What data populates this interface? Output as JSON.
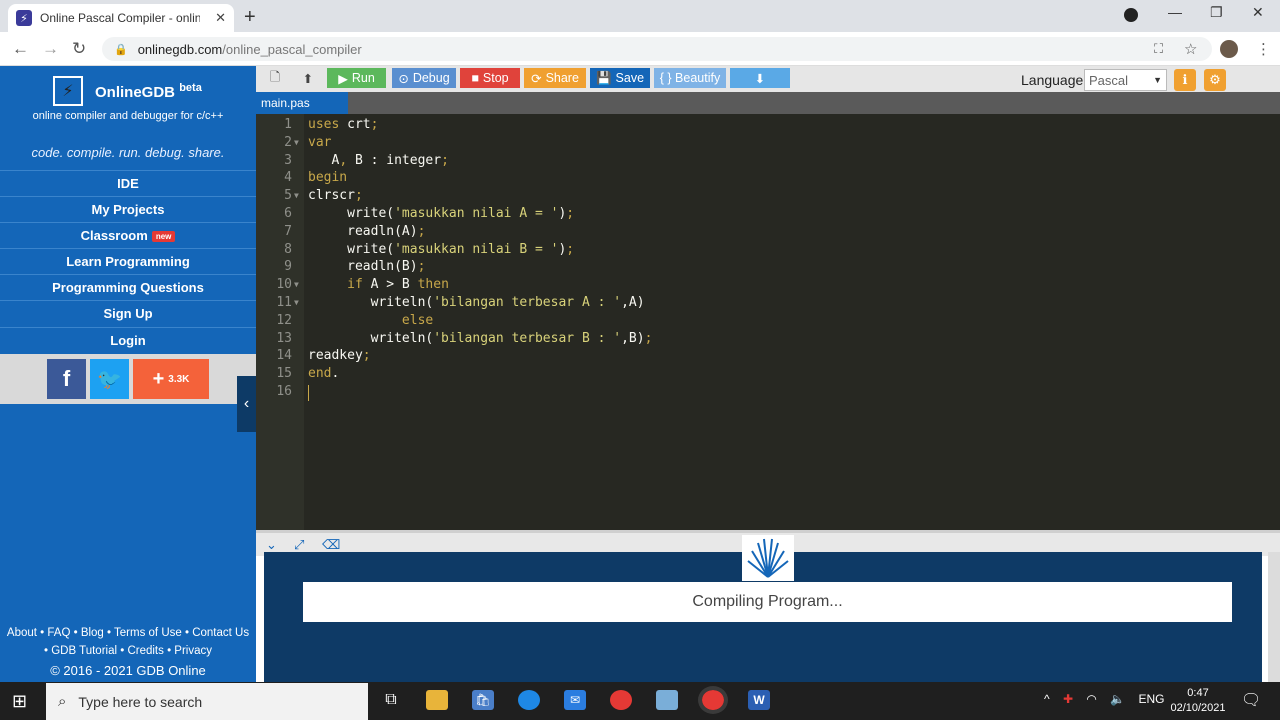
{
  "browser": {
    "tab_title": "Online Pascal Compiler - online e",
    "tab_close": "✕",
    "new_tab": "+",
    "url_host": "onlinegdb.com",
    "url_path": "/online_pascal_compiler"
  },
  "sidebar": {
    "brand": "OnlineGDB",
    "brand_sup": "beta",
    "tagline": "online compiler and debugger for c/c++",
    "motto": "code. compile. run. debug. share.",
    "items": [
      {
        "label": "IDE"
      },
      {
        "label": "My Projects"
      },
      {
        "label": "Classroom",
        "badge": "new"
      },
      {
        "label": "Learn Programming"
      },
      {
        "label": "Programming Questions"
      },
      {
        "label": "Sign Up"
      },
      {
        "label": "Login"
      }
    ],
    "social": {
      "facebook": "f",
      "twitter": "t",
      "share_count": "3.3K"
    },
    "footer": {
      "line1": "About • FAQ • Blog • Terms of Use • Contact Us",
      "line2": "• GDB Tutorial • Credits • Privacy",
      "line3": "© 2016 - 2021 GDB Online"
    }
  },
  "toolbar": {
    "run": "Run",
    "debug": "Debug",
    "stop": "Stop",
    "share": "Share",
    "save": "Save",
    "beautify": "{ } Beautify",
    "language_label": "Language",
    "language_value": "Pascal",
    "colors": {
      "run": "#5cb85c",
      "debug": "#5a8fd0",
      "stop": "#e0433b",
      "share": "#f0a030",
      "save": "#1466b8",
      "beautify": "#7fb3e6",
      "download": "#5aa9e6"
    }
  },
  "editor": {
    "file_tab": "main.pas",
    "lines": [
      {
        "n": "1",
        "html": "<span class='kw'>uses</span> crt<span class='pn'>;</span>"
      },
      {
        "n": "2",
        "fold": true,
        "html": "<span class='kw'>var</span>"
      },
      {
        "n": "3",
        "html": "   A<span class='pn'>,</span> B : integer<span class='pn'>;</span>"
      },
      {
        "n": "4",
        "html": "<span class='kw'>begin</span>"
      },
      {
        "n": "5",
        "fold": true,
        "html": "clrscr<span class='pn'>;</span>"
      },
      {
        "n": "6",
        "html": "     write(<span class='str'>'masukkan nilai A = '</span>)<span class='pn'>;</span>"
      },
      {
        "n": "7",
        "html": "     readln(A)<span class='pn'>;</span>"
      },
      {
        "n": "8",
        "html": "     write(<span class='str'>'masukkan nilai B = '</span>)<span class='pn'>;</span>"
      },
      {
        "n": "9",
        "html": "     readln(B)<span class='pn'>;</span>"
      },
      {
        "n": "10",
        "fold": true,
        "html": "     <span class='kw'>if</span> A &gt; B <span class='kw'>then</span>"
      },
      {
        "n": "11",
        "fold": true,
        "html": "        writeln(<span class='str'>'bilangan terbesar A : '</span>,A)"
      },
      {
        "n": "12",
        "html": "            <span class='kw'>else</span>"
      },
      {
        "n": "13",
        "html": "        writeln(<span class='str'>'bilangan terbesar B : '</span>,B)<span class='pn'>;</span>"
      },
      {
        "n": "14",
        "html": "readkey<span class='pn'>;</span>"
      },
      {
        "n": "15",
        "html": "<span class='kw'>end</span>."
      },
      {
        "n": "16",
        "html": ""
      }
    ]
  },
  "output": {
    "status": "Compiling Program..."
  },
  "taskbar": {
    "search_placeholder": "Type here to search",
    "lang": "ENG",
    "time": "0:47",
    "date": "02/10/2021"
  }
}
